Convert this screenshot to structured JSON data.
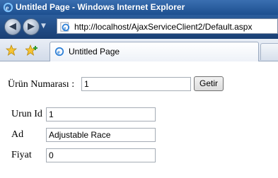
{
  "window": {
    "title": "Untitled Page - Windows Internet Explorer"
  },
  "navigation": {
    "back_icon": "back-arrow-icon",
    "forward_icon": "forward-arrow-icon",
    "address": "http://localhost/AjaxServiceClient2/Default.aspx"
  },
  "tabs": [
    {
      "label": "Untitled Page",
      "icon": "ie-page-icon"
    }
  ],
  "form": {
    "urun_numarasi_label": "Ürün Numarası :",
    "urun_numarasi_value": "1",
    "getir_button": "Getir",
    "fields": [
      {
        "label": "Urun Id",
        "value": "1"
      },
      {
        "label": "Ad",
        "value": "Adjustable Race"
      },
      {
        "label": "Fiyat",
        "value": "0"
      }
    ]
  },
  "colors": {
    "titlebar": "#2a5d9f",
    "accent": "#1d4f8f"
  }
}
